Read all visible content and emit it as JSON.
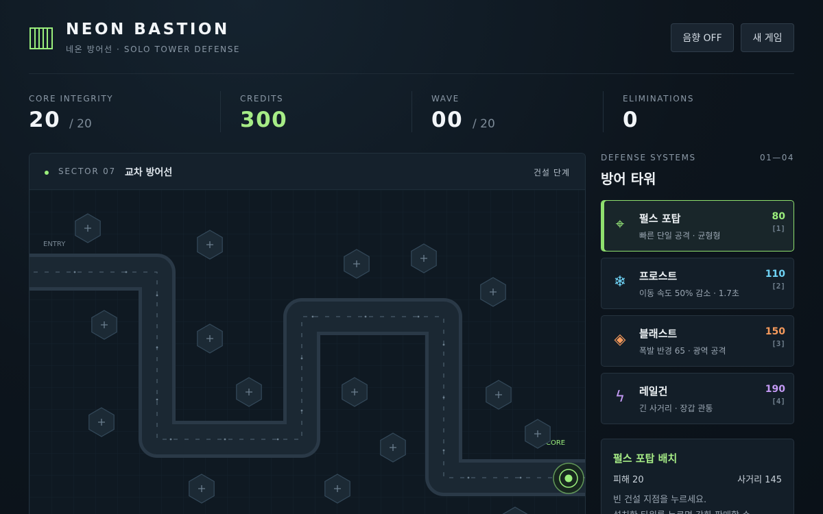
{
  "header": {
    "title": "NEON BASTION",
    "subtitle": "네온 방어선 · SOLO TOWER DEFENSE",
    "sound_label": "음향 OFF",
    "new_game_label": "새 게임"
  },
  "stats": {
    "core": {
      "label": "CORE INTEGRITY",
      "value": "20",
      "max": "/ 20"
    },
    "credits": {
      "label": "CREDITS",
      "value": "300"
    },
    "wave": {
      "label": "WAVE",
      "value": "00",
      "max": "/ 20"
    },
    "eliminations": {
      "label": "ELIMINATIONS",
      "value": "0"
    }
  },
  "board": {
    "sector": "SECTOR 07",
    "sector_name": "교차 방어선",
    "phase": "건설 단계",
    "entry_label": "ENTRY",
    "core_label": "CORE",
    "build_slot_icon": "plus-icon"
  },
  "panel": {
    "kicker": "DEFENSE SYSTEMS",
    "range": "01—04",
    "title": "방어 타워",
    "towers": [
      {
        "name": "펄스 포탑",
        "desc": "빠른 단일 공격 · 균형형",
        "cost": "80",
        "key": "[1]",
        "icon": "crosshair-icon",
        "glyph": "⌖",
        "color": "#9bef7c"
      },
      {
        "name": "프로스트",
        "desc": "이동 속도 50% 감소 · 1.7초",
        "cost": "110",
        "key": "[2]",
        "icon": "snowflake-icon",
        "glyph": "❄",
        "color": "#6fd3f5"
      },
      {
        "name": "블래스트",
        "desc": "폭발 반경 65 · 광역 공격",
        "cost": "150",
        "key": "[3]",
        "icon": "diamond-icon",
        "glyph": "◈",
        "color": "#f59a5c"
      },
      {
        "name": "레일건",
        "desc": "긴 사거리 · 장갑 관통",
        "cost": "190",
        "key": "[4]",
        "icon": "lightning-icon",
        "glyph": "ϟ",
        "color": "#c49af5"
      }
    ]
  },
  "info": {
    "title": "펄스 포탑 배치",
    "damage": "피해 20",
    "range": "사거리 145",
    "hint1": "빈 건설 지점을 누르세요.",
    "hint2": "설치한 타워를 누르면 강화·판매할 수"
  },
  "colors": {
    "accent_green": "#9bef7c",
    "frost_blue": "#6fd3f5",
    "blast_orange": "#f59a5c",
    "rail_purple": "#c49af5",
    "background": "#0d151d"
  }
}
